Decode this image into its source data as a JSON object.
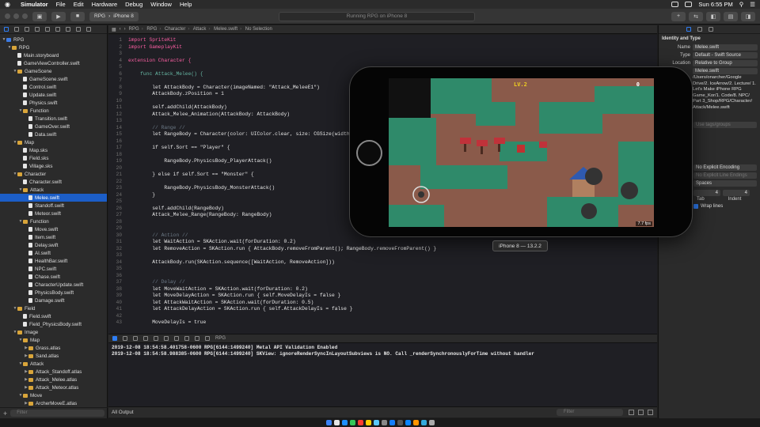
{
  "menubar": {
    "app": "Simulator",
    "items": [
      "File",
      "Edit",
      "Hardware",
      "Debug",
      "Window",
      "Help"
    ],
    "clock": "Sun 6:55 PM"
  },
  "toolbar": {
    "scheme": "RPG",
    "device": "iPhone 8",
    "activity": "Running RPG on iPhone 8"
  },
  "navigator": {
    "filter_placeholder": "Filter",
    "items": [
      {
        "label": "RPG",
        "kind": "proj",
        "depth": 0,
        "open": true
      },
      {
        "label": "RPG",
        "kind": "folder",
        "depth": 1,
        "open": true
      },
      {
        "label": "Main.storyboard",
        "kind": "file",
        "depth": 2
      },
      {
        "label": "GameViewController.swift",
        "kind": "file",
        "depth": 2
      },
      {
        "label": "GameScene",
        "kind": "folder",
        "depth": 2,
        "open": true
      },
      {
        "label": "GameScene.swift",
        "kind": "file",
        "depth": 3
      },
      {
        "label": "Control.swift",
        "kind": "file",
        "depth": 3
      },
      {
        "label": "Update.swift",
        "kind": "file",
        "depth": 3
      },
      {
        "label": "Physics.swift",
        "kind": "file",
        "depth": 3
      },
      {
        "label": "Function",
        "kind": "folder",
        "depth": 3,
        "open": true
      },
      {
        "label": "Transition.swift",
        "kind": "file",
        "depth": 4
      },
      {
        "label": "GameOver.swift",
        "kind": "file",
        "depth": 4
      },
      {
        "label": "Data.swift",
        "kind": "file",
        "depth": 4
      },
      {
        "label": "Map",
        "kind": "folder",
        "depth": 2,
        "open": true
      },
      {
        "label": "Map.sks",
        "kind": "file",
        "depth": 3
      },
      {
        "label": "Field.sks",
        "kind": "file",
        "depth": 3
      },
      {
        "label": "Village.sks",
        "kind": "file",
        "depth": 3
      },
      {
        "label": "Character",
        "kind": "folder",
        "depth": 2,
        "open": true
      },
      {
        "label": "Character.swift",
        "kind": "file",
        "depth": 3
      },
      {
        "label": "Attack",
        "kind": "folder",
        "depth": 3,
        "open": true
      },
      {
        "label": "Melee.swift",
        "kind": "file",
        "depth": 4,
        "selected": true
      },
      {
        "label": "Standoff.swift",
        "kind": "file",
        "depth": 4
      },
      {
        "label": "Meteor.swift",
        "kind": "file",
        "depth": 4
      },
      {
        "label": "Function",
        "kind": "folder",
        "depth": 3,
        "open": true
      },
      {
        "label": "Move.swift",
        "kind": "file",
        "depth": 4
      },
      {
        "label": "Item.swift",
        "kind": "file",
        "depth": 4
      },
      {
        "label": "Delay.swift",
        "kind": "file",
        "depth": 4
      },
      {
        "label": "AI.swift",
        "kind": "file",
        "depth": 4
      },
      {
        "label": "HealthBar.swift",
        "kind": "file",
        "depth": 4
      },
      {
        "label": "NPC.swift",
        "kind": "file",
        "depth": 4
      },
      {
        "label": "Chase.swift",
        "kind": "file",
        "depth": 4
      },
      {
        "label": "CharacterUpdate.swift",
        "kind": "file",
        "depth": 4
      },
      {
        "label": "PhysicsBody.swift",
        "kind": "file",
        "depth": 4
      },
      {
        "label": "Damage.swift",
        "kind": "file",
        "depth": 4
      },
      {
        "label": "Field",
        "kind": "folder",
        "depth": 2,
        "open": true
      },
      {
        "label": "Field.swift",
        "kind": "file",
        "depth": 3
      },
      {
        "label": "Field_PhysicsBody.swift",
        "kind": "file",
        "depth": 3
      },
      {
        "label": "Image",
        "kind": "folder",
        "depth": 2,
        "open": true
      },
      {
        "label": "Map",
        "kind": "folder",
        "depth": 3,
        "open": true
      },
      {
        "label": "Grass.atlas",
        "kind": "folder",
        "depth": 4,
        "open": false
      },
      {
        "label": "Sand.atlas",
        "kind": "folder",
        "depth": 4,
        "open": false
      },
      {
        "label": "Attack",
        "kind": "folder",
        "depth": 3,
        "open": true
      },
      {
        "label": "Attack_Standoff.atlas",
        "kind": "folder",
        "depth": 4,
        "open": false
      },
      {
        "label": "Attack_Melee.atlas",
        "kind": "folder",
        "depth": 4,
        "open": false
      },
      {
        "label": "Attack_Meteor.atlas",
        "kind": "folder",
        "depth": 4,
        "open": false
      },
      {
        "label": "Move",
        "kind": "folder",
        "depth": 3,
        "open": true
      },
      {
        "label": "ArcherMoveE.atlas",
        "kind": "folder",
        "depth": 4,
        "open": false
      }
    ]
  },
  "jumpbar": {
    "crumbs": [
      "RPG",
      "RPG",
      "Character",
      "Attack",
      "Melee.swift",
      "No Selection"
    ]
  },
  "editor": {
    "lines": [
      {
        "n": "1",
        "t": "import SpriteKit",
        "c": "kw"
      },
      {
        "n": "2",
        "t": "import GameplayKit",
        "c": "kw"
      },
      {
        "n": "3",
        "t": "",
        "c": ""
      },
      {
        "n": "4",
        "t": "extension Character {",
        "c": "kw"
      },
      {
        "n": "5",
        "t": "",
        "c": ""
      },
      {
        "n": "6",
        "t": "    func Attack_Melee() {",
        "c": "fn"
      },
      {
        "n": "7",
        "t": "",
        "c": ""
      },
      {
        "n": "8",
        "t": "        let AttackBody = Character(imageNamed: \"Attack_MeleeE1\")",
        "c": ""
      },
      {
        "n": "9",
        "t": "        AttackBody.zPosition = 1",
        "c": ""
      },
      {
        "n": "10",
        "t": "",
        "c": ""
      },
      {
        "n": "11",
        "t": "        self.addChild(AttackBody)",
        "c": ""
      },
      {
        "n": "12",
        "t": "        Attack_Melee_Animation(AttackBody: AttackBody)",
        "c": ""
      },
      {
        "n": "13",
        "t": "",
        "c": ""
      },
      {
        "n": "14",
        "t": "        // Range //",
        "c": "cmt"
      },
      {
        "n": "15",
        "t": "        let RangeBody = Character(color: UIColor.clear, size: CGSize(width:",
        "c": ""
      },
      {
        "n": "16",
        "t": "",
        "c": ""
      },
      {
        "n": "17",
        "t": "        if self.Sort == \"Player\" {",
        "c": ""
      },
      {
        "n": "18",
        "t": "",
        "c": ""
      },
      {
        "n": "19",
        "t": "            RangeBody.PhysicsBody_PlayerAttack()",
        "c": ""
      },
      {
        "n": "20",
        "t": "",
        "c": ""
      },
      {
        "n": "21",
        "t": "        } else if self.Sort == \"Monster\" {",
        "c": ""
      },
      {
        "n": "22",
        "t": "",
        "c": ""
      },
      {
        "n": "23",
        "t": "            RangeBody.PhysicsBody_MonsterAttack()",
        "c": ""
      },
      {
        "n": "24",
        "t": "        }",
        "c": ""
      },
      {
        "n": "25",
        "t": "",
        "c": ""
      },
      {
        "n": "26",
        "t": "        self.addChild(RangeBody)",
        "c": ""
      },
      {
        "n": "27",
        "t": "        Attack_Melee_Range(RangeBody: RangeBody)",
        "c": ""
      },
      {
        "n": "28",
        "t": "",
        "c": ""
      },
      {
        "n": "29",
        "t": "",
        "c": ""
      },
      {
        "n": "30",
        "t": "        // Action //",
        "c": "cmt"
      },
      {
        "n": "31",
        "t": "        let WaitAction = SKAction.wait(forDuration: 0.2)",
        "c": ""
      },
      {
        "n": "32",
        "t": "        let RemoveAction = SKAction.run { AttackBody.removeFromParent(); RangeBody.removeFromParent() }",
        "c": ""
      },
      {
        "n": "33",
        "t": "",
        "c": ""
      },
      {
        "n": "34",
        "t": "        AttackBody.run(SKAction.sequence([WaitAction, RemoveAction]))",
        "c": ""
      },
      {
        "n": "35",
        "t": "",
        "c": ""
      },
      {
        "n": "36",
        "t": "",
        "c": ""
      },
      {
        "n": "37",
        "t": "        // Delay //",
        "c": "cmt"
      },
      {
        "n": "38",
        "t": "        let MoveWaitAction = SKAction.wait(forDuration: 0.2)",
        "c": ""
      },
      {
        "n": "39",
        "t": "        let MoveDelayAction = SKAction.run { self.MoveDelayIs = false }",
        "c": ""
      },
      {
        "n": "40",
        "t": "        let AttackWaitAction = SKAction.wait(forDuration: 0.5)",
        "c": ""
      },
      {
        "n": "41",
        "t": "        let AttackDelayAction = SKAction.run { self.AttackDelayIs = false }",
        "c": ""
      },
      {
        "n": "42",
        "t": "",
        "c": ""
      },
      {
        "n": "43",
        "t": "        MoveDelayIs = true",
        "c": ""
      }
    ]
  },
  "debugbar": {
    "target": "RPG"
  },
  "console": {
    "lines": [
      "2019-12-08 18:54:58.401758-0600 RPG[6144:1499240] Metal API Validation Enabled",
      "2019-12-08 18:54:58.988385-0600 RPG[6144:1499240] SKView: ignoreRenderSyncInLayoutSubviews is NO. Call _renderSynchronouslyForTime without handler"
    ],
    "output_selector": "All Output",
    "filter_placeholder": "Filter"
  },
  "inspector": {
    "identity_title": "Identity and Type",
    "name_label": "Name",
    "name_value": "Melee.swift",
    "type_label": "Type",
    "type_value": "Default - Swift Source",
    "location_label": "Location",
    "location_value": "Relative to Group",
    "file_value": "Melee.swift",
    "full_path": "/Users/onarcher/Google Drive/2. IceArrow/2. Lecture/ 1. Let's Make iPhone RPG Game_Kor/1. Code/8. NPC/ Part 3_Shop/RPG/Character/ Attack/Melee.swift",
    "source_tags_title": "Source Tags",
    "source_tags_placeholder": "Use tags/groups",
    "help_title": "Help",
    "encoding_value": "No Explicit Encoding",
    "line_endings_value": "No Explicit Line Endings",
    "indent_value": "Spaces",
    "tab_value": "4",
    "indent_num": "4",
    "tab_label": "Tab",
    "indent_label": "Indent",
    "wrap_label": "Wrap lines"
  },
  "simulator": {
    "device_label": "iPhone 8 — 13.2.2",
    "level": "LV.2",
    "gold": "0",
    "fps": "7.7 fps"
  },
  "colors": {
    "accent": "#1c5ec7",
    "keyword": "#fc5fa3",
    "comment": "#6c7986",
    "string": "#fc6a5d",
    "ground": "#8a5a4a",
    "grass": "#2f8a6a"
  }
}
